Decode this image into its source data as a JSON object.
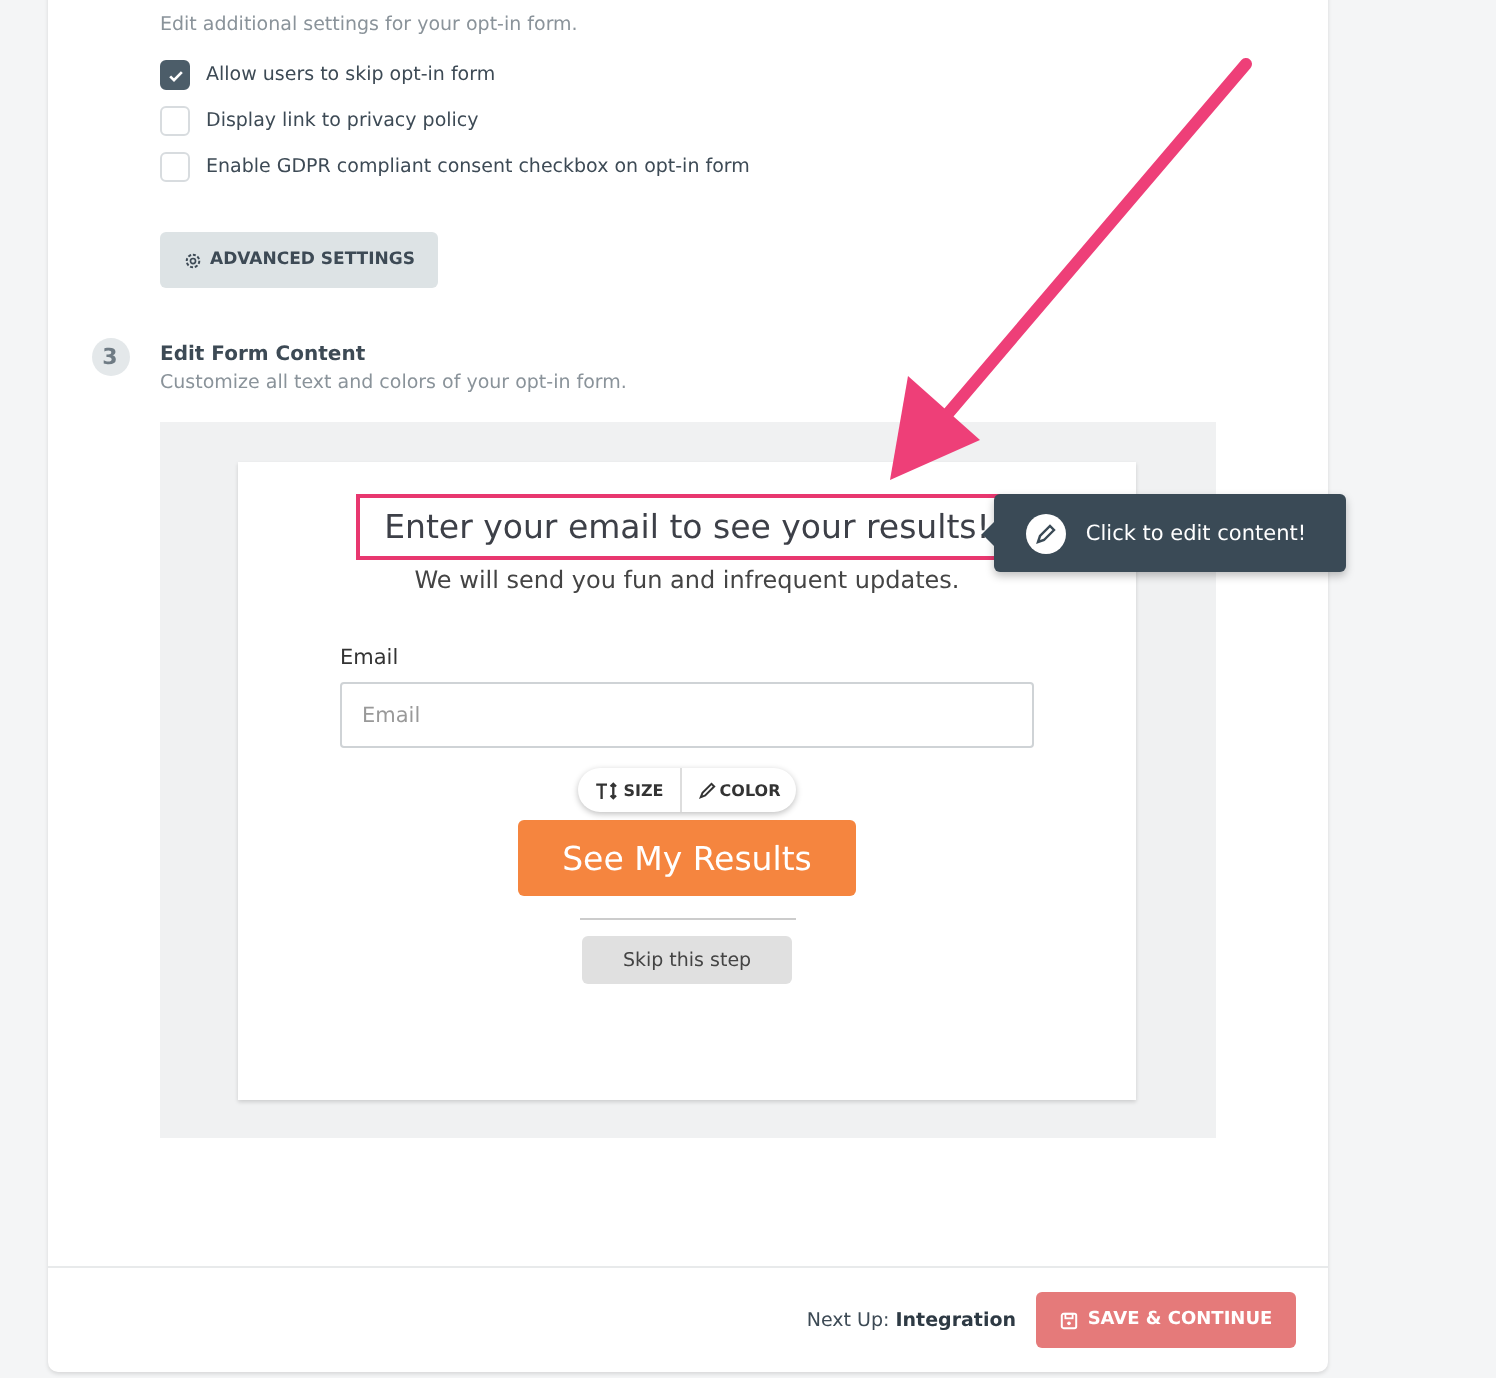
{
  "form_settings": {
    "description": "Edit additional settings for your opt-in form.",
    "options": [
      {
        "label": "Allow users to skip opt-in form",
        "checked": true
      },
      {
        "label": "Display link to privacy policy",
        "checked": false
      },
      {
        "label": "Enable GDPR compliant consent checkbox on opt-in form",
        "checked": false
      }
    ],
    "advanced_button": "ADVANCED SETTINGS"
  },
  "edit_content": {
    "step": "3",
    "title": "Edit Form Content",
    "description": "Customize all text and colors of your opt-in form.",
    "preview": {
      "heading": "Enter your email to see your results!",
      "subheading": "We will send you fun and infrequent updates.",
      "tooltip": "Click to edit content!",
      "email_label": "Email",
      "email_placeholder": "Email",
      "toolbar": [
        "SIZE",
        "COLOR"
      ],
      "submit_button": "See My Results",
      "skip_button": "Skip this step"
    }
  },
  "footer": {
    "next_up": "Next Up: **Integration**",
    "save_button": "SAVE & CONTINUE"
  }
}
